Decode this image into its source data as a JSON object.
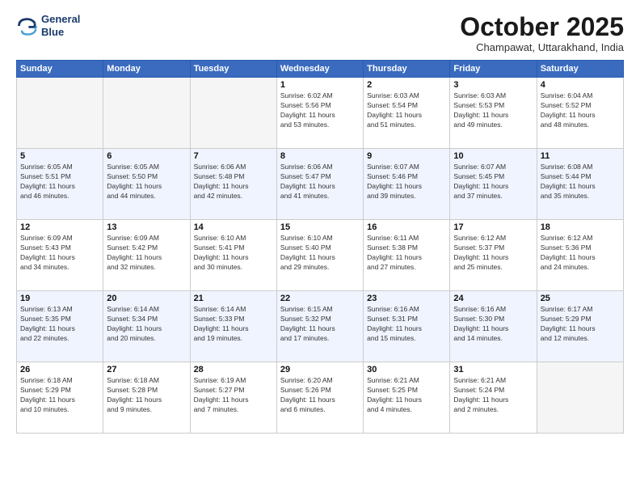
{
  "logo": {
    "line1": "General",
    "line2": "Blue"
  },
  "title": "October 2025",
  "subtitle": "Champawat, Uttarakhand, India",
  "days_header": [
    "Sunday",
    "Monday",
    "Tuesday",
    "Wednesday",
    "Thursday",
    "Friday",
    "Saturday"
  ],
  "weeks": [
    [
      {
        "day": "",
        "info": ""
      },
      {
        "day": "",
        "info": ""
      },
      {
        "day": "",
        "info": ""
      },
      {
        "day": "1",
        "info": "Sunrise: 6:02 AM\nSunset: 5:56 PM\nDaylight: 11 hours\nand 53 minutes."
      },
      {
        "day": "2",
        "info": "Sunrise: 6:03 AM\nSunset: 5:54 PM\nDaylight: 11 hours\nand 51 minutes."
      },
      {
        "day": "3",
        "info": "Sunrise: 6:03 AM\nSunset: 5:53 PM\nDaylight: 11 hours\nand 49 minutes."
      },
      {
        "day": "4",
        "info": "Sunrise: 6:04 AM\nSunset: 5:52 PM\nDaylight: 11 hours\nand 48 minutes."
      }
    ],
    [
      {
        "day": "5",
        "info": "Sunrise: 6:05 AM\nSunset: 5:51 PM\nDaylight: 11 hours\nand 46 minutes."
      },
      {
        "day": "6",
        "info": "Sunrise: 6:05 AM\nSunset: 5:50 PM\nDaylight: 11 hours\nand 44 minutes."
      },
      {
        "day": "7",
        "info": "Sunrise: 6:06 AM\nSunset: 5:48 PM\nDaylight: 11 hours\nand 42 minutes."
      },
      {
        "day": "8",
        "info": "Sunrise: 6:06 AM\nSunset: 5:47 PM\nDaylight: 11 hours\nand 41 minutes."
      },
      {
        "day": "9",
        "info": "Sunrise: 6:07 AM\nSunset: 5:46 PM\nDaylight: 11 hours\nand 39 minutes."
      },
      {
        "day": "10",
        "info": "Sunrise: 6:07 AM\nSunset: 5:45 PM\nDaylight: 11 hours\nand 37 minutes."
      },
      {
        "day": "11",
        "info": "Sunrise: 6:08 AM\nSunset: 5:44 PM\nDaylight: 11 hours\nand 35 minutes."
      }
    ],
    [
      {
        "day": "12",
        "info": "Sunrise: 6:09 AM\nSunset: 5:43 PM\nDaylight: 11 hours\nand 34 minutes."
      },
      {
        "day": "13",
        "info": "Sunrise: 6:09 AM\nSunset: 5:42 PM\nDaylight: 11 hours\nand 32 minutes."
      },
      {
        "day": "14",
        "info": "Sunrise: 6:10 AM\nSunset: 5:41 PM\nDaylight: 11 hours\nand 30 minutes."
      },
      {
        "day": "15",
        "info": "Sunrise: 6:10 AM\nSunset: 5:40 PM\nDaylight: 11 hours\nand 29 minutes."
      },
      {
        "day": "16",
        "info": "Sunrise: 6:11 AM\nSunset: 5:38 PM\nDaylight: 11 hours\nand 27 minutes."
      },
      {
        "day": "17",
        "info": "Sunrise: 6:12 AM\nSunset: 5:37 PM\nDaylight: 11 hours\nand 25 minutes."
      },
      {
        "day": "18",
        "info": "Sunrise: 6:12 AM\nSunset: 5:36 PM\nDaylight: 11 hours\nand 24 minutes."
      }
    ],
    [
      {
        "day": "19",
        "info": "Sunrise: 6:13 AM\nSunset: 5:35 PM\nDaylight: 11 hours\nand 22 minutes."
      },
      {
        "day": "20",
        "info": "Sunrise: 6:14 AM\nSunset: 5:34 PM\nDaylight: 11 hours\nand 20 minutes."
      },
      {
        "day": "21",
        "info": "Sunrise: 6:14 AM\nSunset: 5:33 PM\nDaylight: 11 hours\nand 19 minutes."
      },
      {
        "day": "22",
        "info": "Sunrise: 6:15 AM\nSunset: 5:32 PM\nDaylight: 11 hours\nand 17 minutes."
      },
      {
        "day": "23",
        "info": "Sunrise: 6:16 AM\nSunset: 5:31 PM\nDaylight: 11 hours\nand 15 minutes."
      },
      {
        "day": "24",
        "info": "Sunrise: 6:16 AM\nSunset: 5:30 PM\nDaylight: 11 hours\nand 14 minutes."
      },
      {
        "day": "25",
        "info": "Sunrise: 6:17 AM\nSunset: 5:29 PM\nDaylight: 11 hours\nand 12 minutes."
      }
    ],
    [
      {
        "day": "26",
        "info": "Sunrise: 6:18 AM\nSunset: 5:29 PM\nDaylight: 11 hours\nand 10 minutes."
      },
      {
        "day": "27",
        "info": "Sunrise: 6:18 AM\nSunset: 5:28 PM\nDaylight: 11 hours\nand 9 minutes."
      },
      {
        "day": "28",
        "info": "Sunrise: 6:19 AM\nSunset: 5:27 PM\nDaylight: 11 hours\nand 7 minutes."
      },
      {
        "day": "29",
        "info": "Sunrise: 6:20 AM\nSunset: 5:26 PM\nDaylight: 11 hours\nand 6 minutes."
      },
      {
        "day": "30",
        "info": "Sunrise: 6:21 AM\nSunset: 5:25 PM\nDaylight: 11 hours\nand 4 minutes."
      },
      {
        "day": "31",
        "info": "Sunrise: 6:21 AM\nSunset: 5:24 PM\nDaylight: 11 hours\nand 2 minutes."
      },
      {
        "day": "",
        "info": ""
      }
    ]
  ]
}
